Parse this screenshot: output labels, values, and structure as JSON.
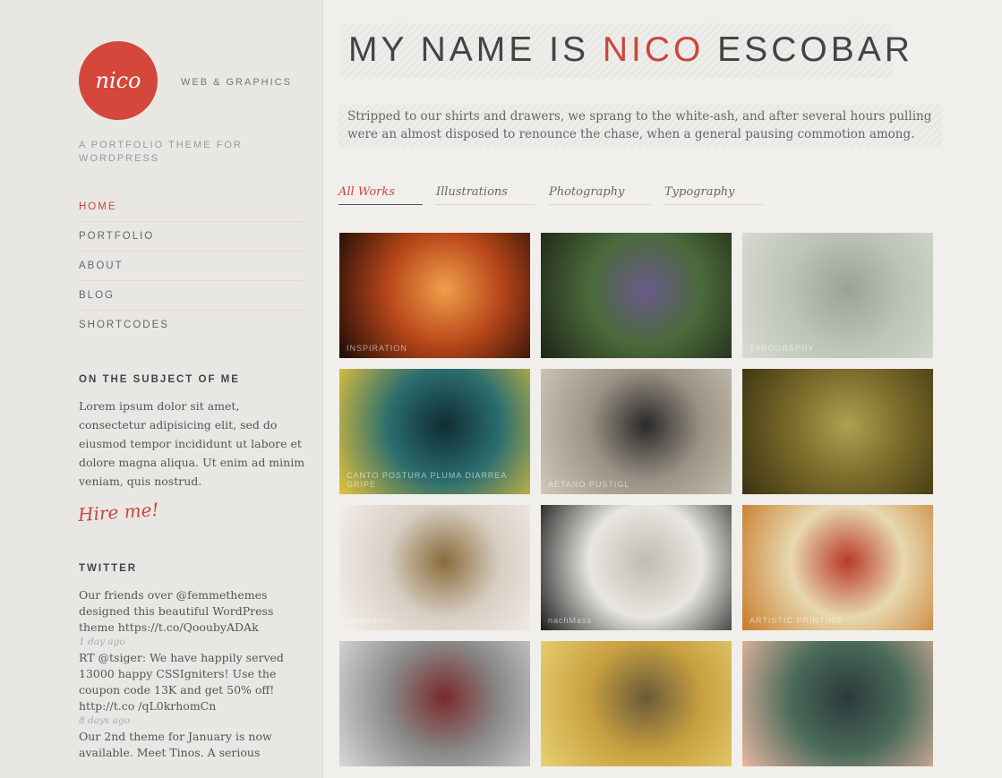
{
  "site": {
    "logo_text": "nico",
    "tagline_short": "WEB & GRAPHICS",
    "tagline_long": "A PORTFOLIO THEME FOR WORDPRESS"
  },
  "nav": [
    {
      "label": "HOME",
      "active": true
    },
    {
      "label": "PORTFOLIO"
    },
    {
      "label": "ABOUT"
    },
    {
      "label": "BLOG"
    },
    {
      "label": "SHORTCODES"
    }
  ],
  "about": {
    "title": "ON THE SUBJECT OF ME",
    "text": "Lorem ipsum dolor sit amet, consectetur adipisicing elit, sed do eiusmod tempor incididunt ut labore et dolore magna aliqua. Ut enim ad minim veniam, quis nostrud.",
    "hire_label": "Hire me!"
  },
  "twitter": {
    "title": "TWITTER",
    "tweets": [
      {
        "text": "Our friends over @femmethemes designed this beautiful WordPress theme https://t.co/QooubyADAk",
        "time": "1 day ago"
      },
      {
        "text": "RT @tsiger: We have happily served 13000 happy CSSIgniters! Use the coupon code 13K and get 50% off! http://t.co /qL0krhomCn",
        "time": "8 days ago"
      },
      {
        "text": "Our 2nd theme for January is now available. Meet Tinos. A serious",
        "time": ""
      }
    ]
  },
  "header": {
    "title_pre": "MY NAME IS ",
    "title_accent": "NICO",
    "title_post": " ESCOBAR",
    "intro": "Stripped to our shirts and drawers, we sprang to the white-ash, and after several hours pulling were an almost disposed to renounce the chase, when a general pausing commotion among."
  },
  "filters": [
    {
      "label": "All Works",
      "active": true
    },
    {
      "label": "Illustrations"
    },
    {
      "label": "Photography"
    },
    {
      "label": "Typography"
    }
  ],
  "gallery": [
    {
      "name": "thumb-inspiration-sunset",
      "caption": "INSPIRATION",
      "colors": [
        "#1a0b05",
        "#b8461a",
        "#f0a04a"
      ]
    },
    {
      "name": "thumb-fantasy-creature",
      "caption": "",
      "colors": [
        "#1e2418",
        "#4a6a3a",
        "#6a5a8a"
      ]
    },
    {
      "name": "thumb-typography-3d",
      "caption": "TYPOGRAPHY",
      "colors": [
        "#d8dcd2",
        "#bcc2b6",
        "#9aa393"
      ]
    },
    {
      "name": "thumb-canto-signage",
      "caption": "CANTO POSTURA PLUMA DIARREA GRIPE",
      "colors": [
        "#e7c23a",
        "#2b6e6e",
        "#102c34"
      ]
    },
    {
      "name": "thumb-wall-poster",
      "caption": "AETANO PUSTIGL",
      "colors": [
        "#cfc8bb",
        "#9c9386",
        "#2a2a2a"
      ]
    },
    {
      "name": "thumb-horse-rider",
      "caption": "",
      "colors": [
        "#3b3212",
        "#7a6a2a",
        "#b0a050"
      ]
    },
    {
      "name": "thumb-glitter-inspiration",
      "caption": "Inspiration",
      "colors": [
        "#f4f1ec",
        "#d8cfc4",
        "#8a6a3a"
      ]
    },
    {
      "name": "thumb-nachmass-book",
      "caption": "nachMass",
      "colors": [
        "#1c1c1c",
        "#e8e6e0",
        "#bfbcb5"
      ]
    },
    {
      "name": "thumb-artistic-printing",
      "caption": "ARTISTIC PRINTING",
      "colors": [
        "#c87a2a",
        "#e8d8b0",
        "#b83a2a"
      ]
    },
    {
      "name": "thumb-volleyball-crowd",
      "caption": "",
      "colors": [
        "#d8d8d8",
        "#8a8a8a",
        "#7a2a2a"
      ]
    },
    {
      "name": "thumb-yellow-illustration",
      "caption": "",
      "colors": [
        "#e8d070",
        "#c8a040",
        "#6a5a3a"
      ]
    },
    {
      "name": "thumb-mountain-car",
      "caption": "",
      "colors": [
        "#e8b8a0",
        "#4a6a5a",
        "#2a3a3a"
      ]
    }
  ]
}
